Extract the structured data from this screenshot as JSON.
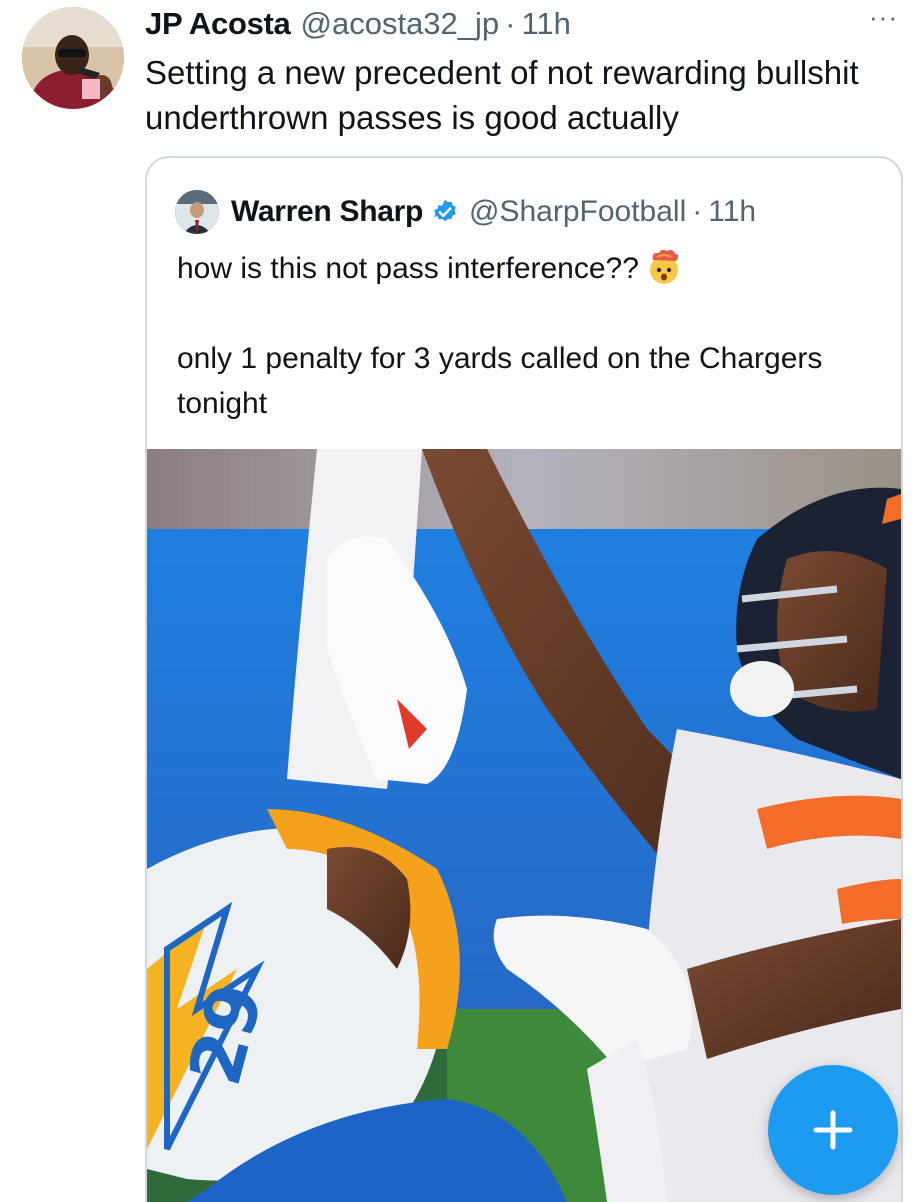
{
  "tweet": {
    "author_name": "JP Acosta",
    "author_handle": "@acosta32_jp",
    "separator": "·",
    "time": "11h",
    "more_label": "···",
    "text": "Setting a new precedent of not rewarding bullshit underthrown passes is good actually"
  },
  "quoted_tweet": {
    "author_name": "Warren Sharp",
    "author_handle": "@SharpFootball",
    "separator": "·",
    "time": "11h",
    "verified": true,
    "text_line1": "how is this not pass interference??",
    "emoji": "exploding-head",
    "text_rest": "only 1 penalty for 3 yards called on the Chargers tonight",
    "media": {
      "icon": "football-photo",
      "jersey_number": "29"
    }
  },
  "fab": {
    "label": "+",
    "icon": "plus-icon"
  },
  "colors": {
    "accent": "#1d9bf0",
    "text": "#0f1419",
    "muted": "#536471",
    "border": "#cfd9de"
  }
}
